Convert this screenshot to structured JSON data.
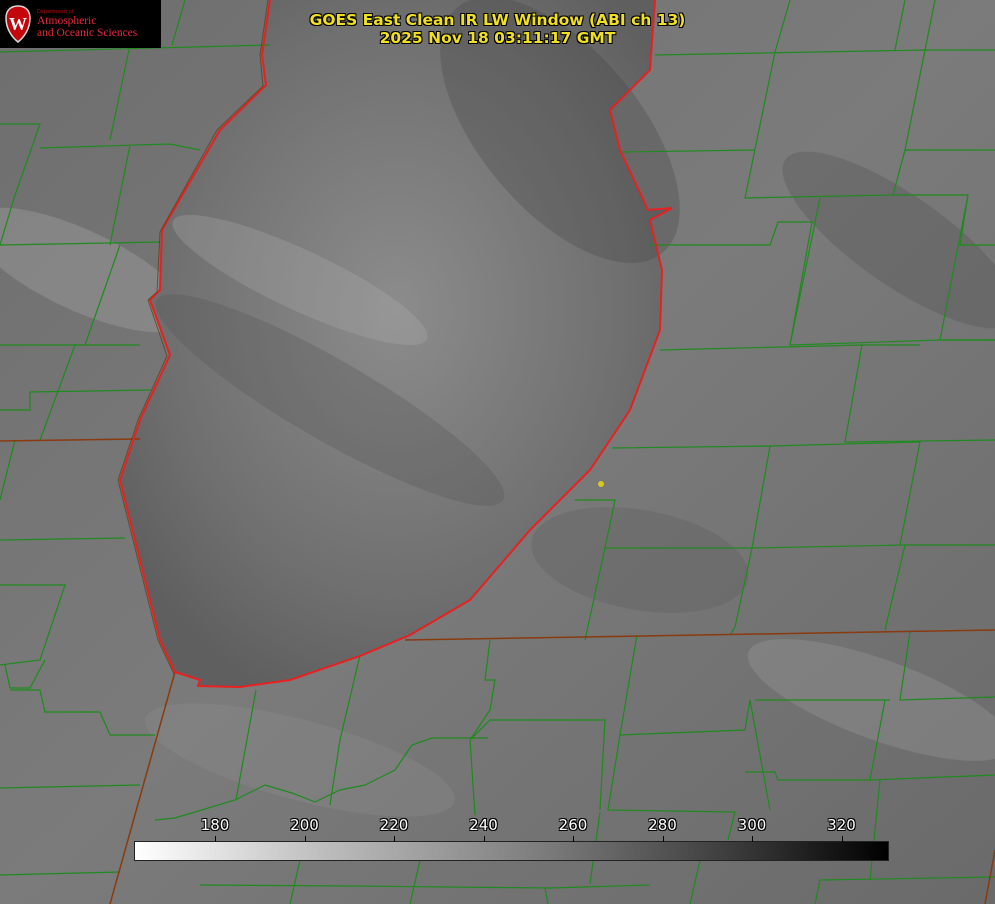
{
  "title": {
    "line1": "GOES East Clean IR LW Window (ABI ch 13)",
    "line2": "2025 Nov 18 03:11:17 GMT"
  },
  "logo": {
    "department": "Department of",
    "line1": "Atmospheric",
    "line2": "and Oceanic Sciences",
    "crest_letter": "W"
  },
  "colorbar": {
    "ticks": [
      "180",
      "200",
      "220",
      "240",
      "260",
      "280",
      "300",
      "320"
    ]
  },
  "colors": {
    "title_text": "#f0e020",
    "county_lines": "#1f8a1f",
    "lake_outline": "#e82020",
    "state_lines": "#8a3a10",
    "marker": "#d8c820"
  }
}
